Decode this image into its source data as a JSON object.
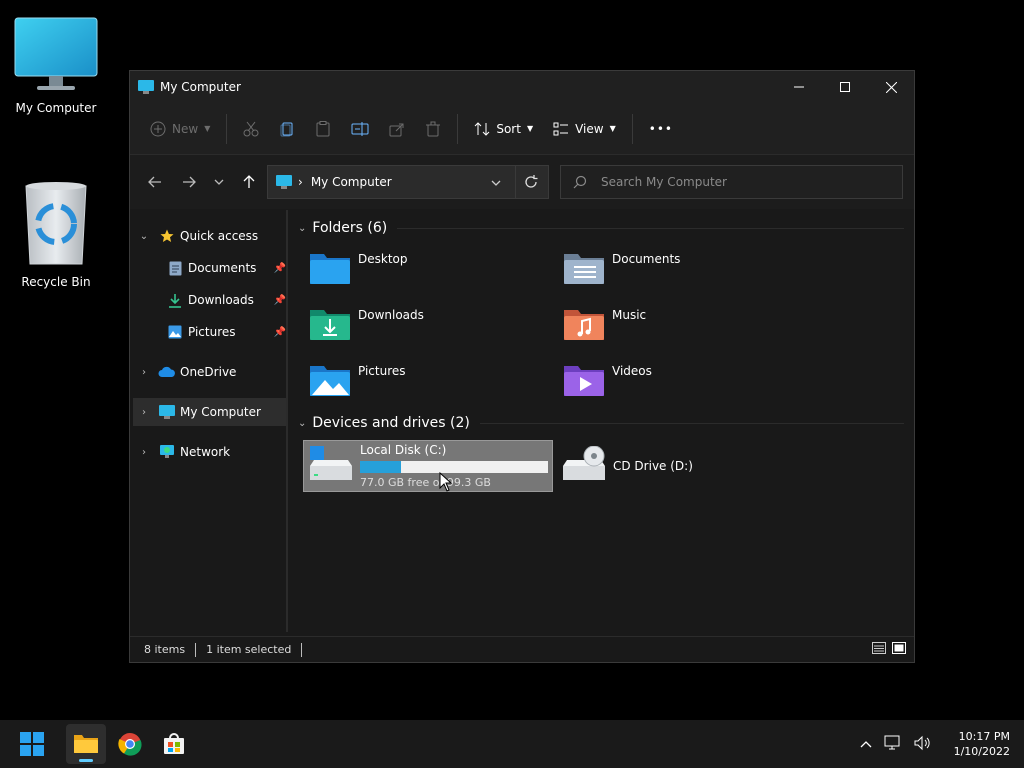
{
  "desktop": {
    "icons": [
      {
        "label": "My Computer"
      },
      {
        "label": "Recycle Bin"
      }
    ]
  },
  "window": {
    "title": "My Computer",
    "toolbar": {
      "new_label": "New",
      "sort_label": "Sort",
      "view_label": "View",
      "more_label": "•••"
    },
    "address": {
      "separator": "›",
      "path": "My Computer"
    },
    "search": {
      "placeholder": "Search My Computer"
    },
    "sidebar": {
      "quick_access": "Quick access",
      "documents": "Documents",
      "downloads": "Downloads",
      "pictures": "Pictures",
      "onedrive": "OneDrive",
      "mycomputer": "My Computer",
      "network": "Network"
    },
    "folders_header": "Folders (6)",
    "folders": [
      {
        "name": "Desktop"
      },
      {
        "name": "Documents"
      },
      {
        "name": "Downloads"
      },
      {
        "name": "Music"
      },
      {
        "name": "Pictures"
      },
      {
        "name": "Videos"
      }
    ],
    "devices_header": "Devices and drives (2)",
    "drives": [
      {
        "name": "Local Disk (C:)",
        "free_text": "77.0 GB free of 99.3 GB",
        "used_fraction": 0.22
      },
      {
        "name": "CD Drive (D:)"
      }
    ],
    "status": {
      "items": "8 items",
      "selected": "1 item selected"
    }
  },
  "taskbar": {
    "clock_time": "10:17 PM",
    "clock_date": "1/10/2022"
  },
  "colors": {
    "accent": "#26a0da",
    "window_bg": "#191919",
    "taskbar_bg": "#1a1a1a"
  }
}
